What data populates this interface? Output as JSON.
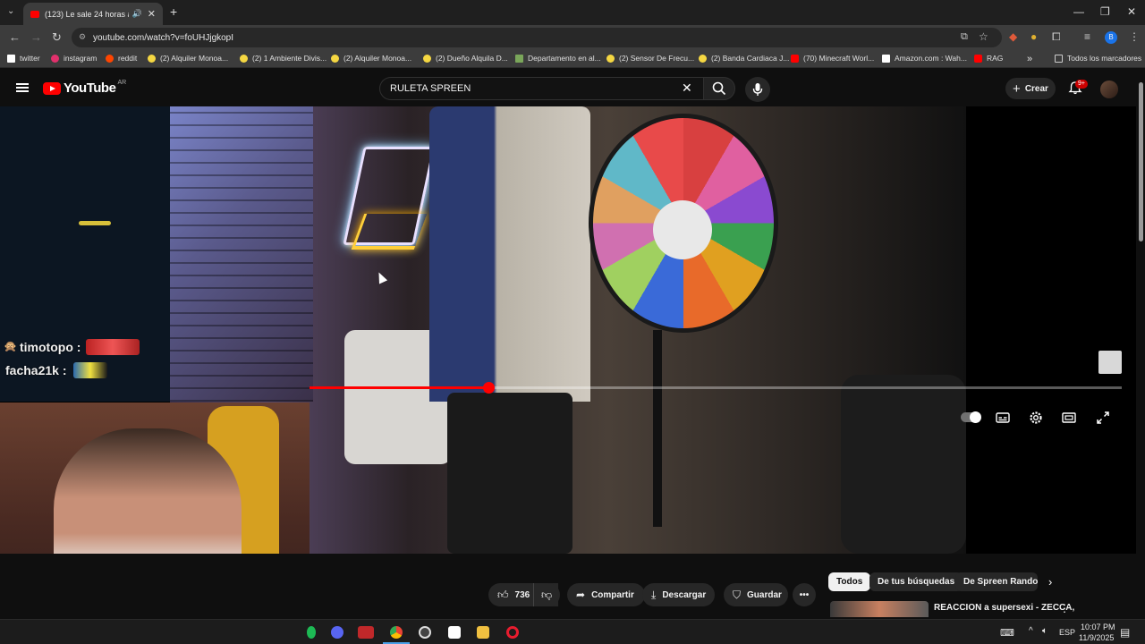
{
  "browser": {
    "tab_title": "(123) Le sale 24 horas a Spr",
    "url": "youtube.com/watch?v=foUHJjgkopI",
    "bookmarks": [
      {
        "label": "twitter",
        "color": "#ffffff"
      },
      {
        "label": "instagram",
        "color": "#e1306c"
      },
      {
        "label": "reddit",
        "color": "#ff4500"
      },
      {
        "label": "(2) Alquiler Monoa...",
        "color": "#f5d742"
      },
      {
        "label": "(2) 1 Ambiente Divis...",
        "color": "#f5d742"
      },
      {
        "label": "(2) Alquiler Monoa...",
        "color": "#f5d742"
      },
      {
        "label": "(2) Dueño Alquila D...",
        "color": "#f5d742"
      },
      {
        "label": "Departamento en al...",
        "color": "#7aa65a"
      },
      {
        "label": "(2) Sensor De Frecu...",
        "color": "#f5d742"
      },
      {
        "label": "(2) Banda Cardiaca J...",
        "color": "#f5d742"
      },
      {
        "label": "(70) Minecraft Worl...",
        "color": "#ff0000"
      },
      {
        "label": "Amazon.com : Wah...",
        "color": "#ffffff"
      },
      {
        "label": "RAG",
        "color": "#ff0000"
      }
    ],
    "all_bookmarks": "Todos los marcadores"
  },
  "youtube": {
    "logo_text": "YouTube",
    "country_code": "AR",
    "search_value": "RULETA SPREEN",
    "create_label": "Crear",
    "notification_badge": "9+"
  },
  "stream_overlay": {
    "chat": [
      {
        "user": "timotopo :"
      },
      {
        "user": "facha21k :"
      }
    ]
  },
  "player": {
    "progress_fraction": 0.22
  },
  "actions": {
    "likes": "736",
    "share": "Compartir",
    "download": "Descargar",
    "save": "Guardar"
  },
  "chips": [
    "Todos",
    "De tus búsquedas",
    "De Spreen Random"
  ],
  "recommendation": {
    "title": "REACCION a supersexi - ZECCA,"
  },
  "taskbar": {
    "lang": "ESP",
    "time": "10:07 PM",
    "date": "11/9/2025"
  },
  "colors": {
    "accent": "#ff0000",
    "background": "#0f0f0f"
  }
}
